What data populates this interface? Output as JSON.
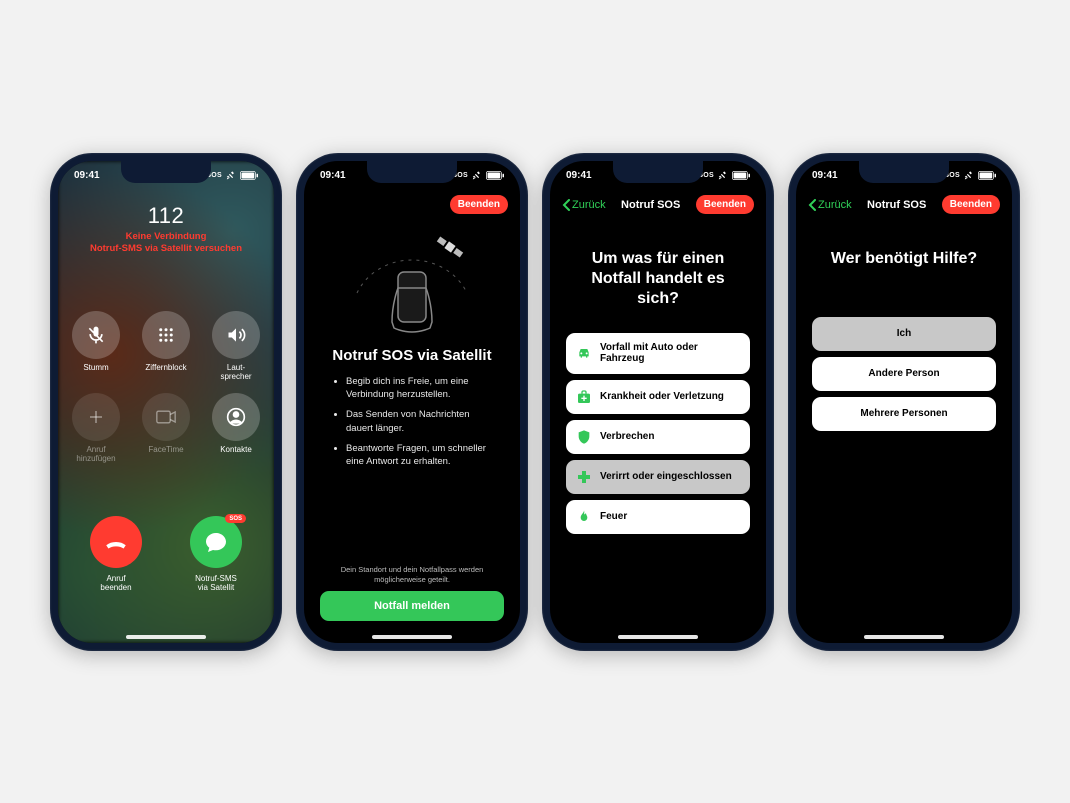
{
  "status": {
    "time": "09:41",
    "sos_label": "SOS"
  },
  "phone1": {
    "number": "112",
    "fail_line1": "Keine Verbindung",
    "fail_line2": "Notruf-SMS via Satellit versuchen",
    "buttons": {
      "mute": "Stumm",
      "keypad": "Ziffernblock",
      "speaker": "Laut-\nsprecher",
      "add": "Anruf\nhinzufügen",
      "facetime": "FaceTime",
      "contacts": "Kontakte"
    },
    "hangup": "Anruf\nbeenden",
    "sms": "Notruf-SMS\nvia Satellit",
    "sms_badge": "SOS"
  },
  "phone2": {
    "end": "Beenden",
    "title": "Notruf SOS via Satellit",
    "bullets": [
      "Begib dich ins Freie, um eine Verbindung herzustellen.",
      "Das Senden von Nachrichten dauert länger.",
      "Beantworte Fragen, um schneller eine Antwort zu erhalten."
    ],
    "note": "Dein Standort und dein Notfallpass werden möglicherweise geteilt.",
    "cta": "Notfall melden"
  },
  "phone3": {
    "back": "Zurück",
    "nav_title": "Notruf SOS",
    "end": "Beenden",
    "question": "Um was für einen Notfall handelt es sich?",
    "options": [
      {
        "icon": "car",
        "label": "Vorfall mit Auto oder Fahrzeug"
      },
      {
        "icon": "med",
        "label": "Krankheit oder Verletzung"
      },
      {
        "icon": "shield",
        "label": "Verbrechen"
      },
      {
        "icon": "cross",
        "label": "Verirrt oder eingeschlossen",
        "selected": true
      },
      {
        "icon": "flame",
        "label": "Feuer"
      }
    ]
  },
  "phone4": {
    "back": "Zurück",
    "nav_title": "Notruf SOS",
    "end": "Beenden",
    "question": "Wer benötigt Hilfe?",
    "options": [
      {
        "label": "Ich",
        "selected": true
      },
      {
        "label": "Andere Person"
      },
      {
        "label": "Mehrere Personen"
      }
    ]
  }
}
